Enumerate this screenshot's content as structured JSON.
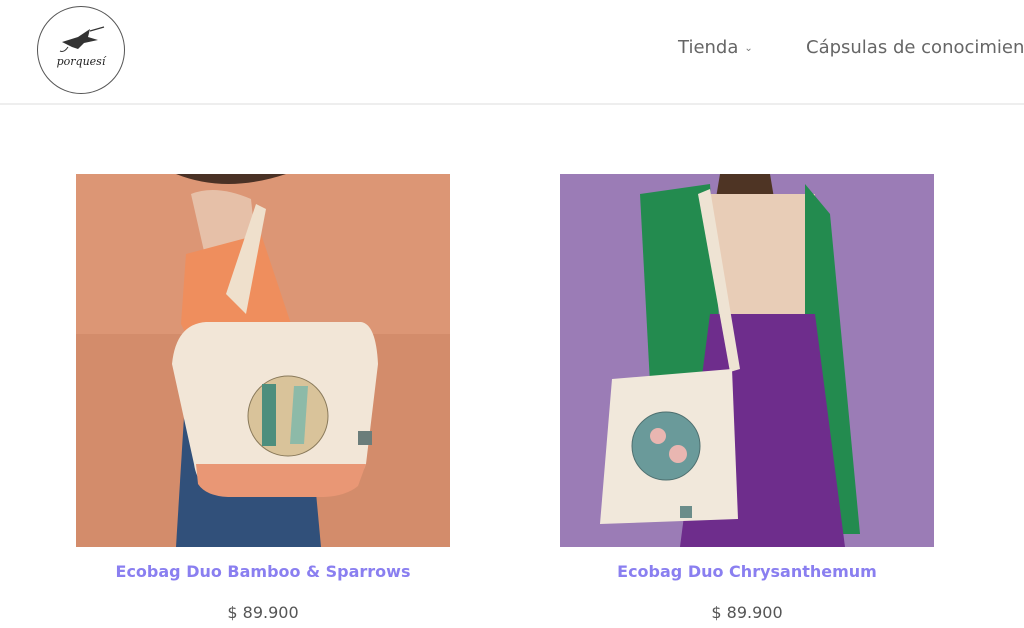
{
  "header": {
    "logo_text": "porquesí",
    "nav": [
      {
        "label": "Tienda"
      },
      {
        "label": "Cápsulas de conocimiento"
      }
    ]
  },
  "products": [
    {
      "name": "Ecobag Duo Bamboo & Sparrows",
      "price": "$ 89.900"
    },
    {
      "name": "Ecobag Duo Chrysanthemum",
      "price": "$ 89.900"
    }
  ],
  "colors": {
    "title_accent": "#8a7ff0",
    "price_text": "#555555",
    "nav_text": "#666666",
    "bg_product1": "#d68f6d",
    "bg_product2": "#9c7bb7"
  }
}
